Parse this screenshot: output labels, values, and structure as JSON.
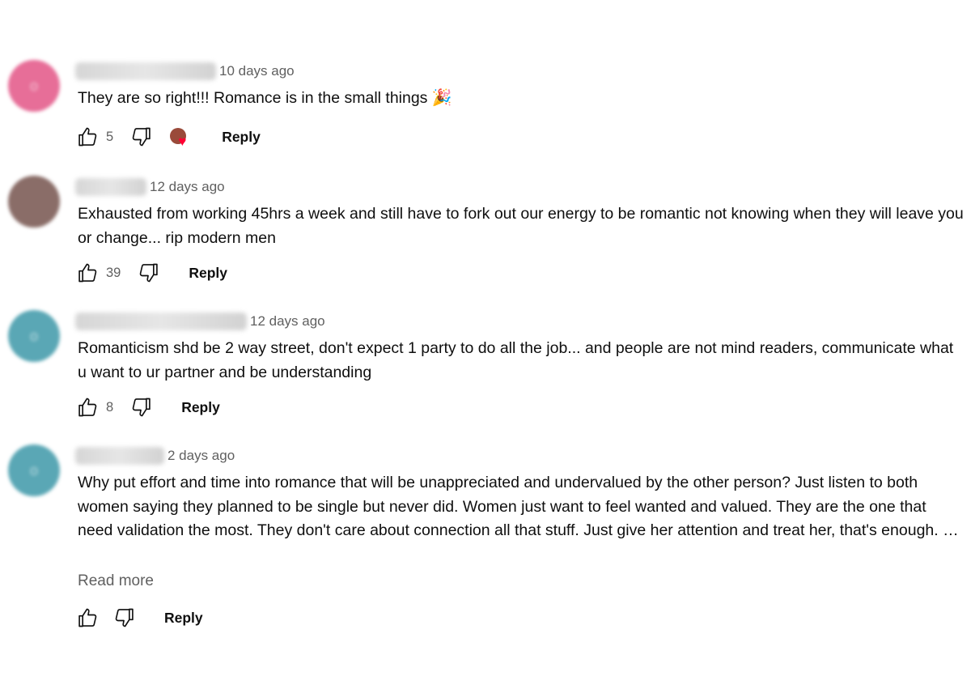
{
  "comments": [
    {
      "time": "10 days ago",
      "text": "They are so right!!! Romance is in the small things",
      "emoji": "🎉",
      "likes": "5",
      "reply_label": "Reply",
      "avatar_color": "#e76e98",
      "hearted": true
    },
    {
      "time": "12 days ago",
      "text": "Exhausted from working 45hrs a week and still have to fork out our energy to be romantic not knowing when they will leave you or change... rip modern men",
      "likes": "39",
      "reply_label": "Reply",
      "avatar_color": "#8a6d68"
    },
    {
      "time": "12 days ago",
      "text": "Romanticism shd be 2 way street, don't expect 1 party to do all the job... and people are not mind readers, communicate what u want to ur partner and be understanding",
      "likes": "8",
      "reply_label": "Reply",
      "avatar_color": "#5aa7b5"
    },
    {
      "time": "2 days ago",
      "text": "Why put effort and time into romance that will be unappreciated and undervalued by the other person? Just listen to both women saying they planned to be single but never did. Women just want to feel wanted and valued. They are the one that need validation the most. They don't care about connection all that stuff. Just give her attention and treat her, that's enough. …",
      "read_more": "Read more",
      "likes": "",
      "reply_label": "Reply",
      "avatar_color": "#5aa7b5"
    }
  ],
  "icons": {
    "like": "thumbs-up-icon",
    "dislike": "thumbs-down-icon",
    "heart": "creator-heart-icon"
  }
}
